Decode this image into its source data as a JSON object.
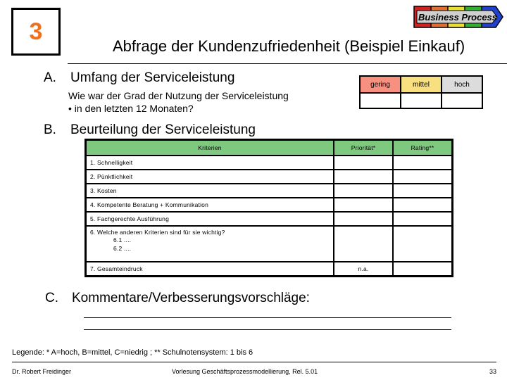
{
  "slide": {
    "number": "3",
    "title": "Abfrage der Kundenzufriedenheit (Beispiel Einkauf)",
    "logo_text": "Business Process",
    "logo_colors": [
      "#d42020",
      "#e07030",
      "#e8e030",
      "#30b030",
      "#2040d0"
    ]
  },
  "section_a": {
    "letter": "A.",
    "heading": "Umfang der Serviceleistung",
    "question_line1": "Wie war der Grad der Nutzung der Serviceleistung",
    "question_line2": "• in den letzten 12 Monaten?",
    "scale": [
      {
        "label": "gering",
        "color": "#f89080",
        "value": ""
      },
      {
        "label": "mittel",
        "color": "#f8e080",
        "value": ""
      },
      {
        "label": "hoch",
        "color": "#dcdcdc",
        "value": ""
      }
    ]
  },
  "section_b": {
    "letter": "B.",
    "heading": "Beurteilung der Serviceleistung",
    "header_color": "#7fc87f",
    "columns": [
      "Kriterien",
      "Priorität*",
      "Rating**"
    ],
    "rows": [
      {
        "criterion": "1. Schnelligkeit",
        "priority": "",
        "rating": ""
      },
      {
        "criterion": "2. Pünktlichkeit",
        "priority": "",
        "rating": ""
      },
      {
        "criterion": "3. Kosten",
        "priority": "",
        "rating": ""
      },
      {
        "criterion": "4. Kompetente Beratung + Kommunikation",
        "priority": "",
        "rating": ""
      },
      {
        "criterion": "5. Fachgerechte Ausführung",
        "priority": "",
        "rating": ""
      },
      {
        "criterion": "6. Welche anderen Kriterien sind für sie wichtig?",
        "sub": [
          "6.1 ....",
          "6.2 ...."
        ],
        "priority": "",
        "rating": ""
      },
      {
        "criterion": "7. Gesamteindruck",
        "priority": "n.a.",
        "rating": ""
      }
    ]
  },
  "section_c": {
    "letter": "C.",
    "heading": "Kommentare/Verbesserungsvorschläge:"
  },
  "legend": "Legende: * A=hoch, B=mittel, C=niedrig ; ** Schulnotensystem: 1 bis 6",
  "footer": {
    "author": "Dr. Robert Freidinger",
    "course": "Vorlesung Geschäftsprozessmodellierung, Rel. 5.01",
    "page": "33"
  }
}
